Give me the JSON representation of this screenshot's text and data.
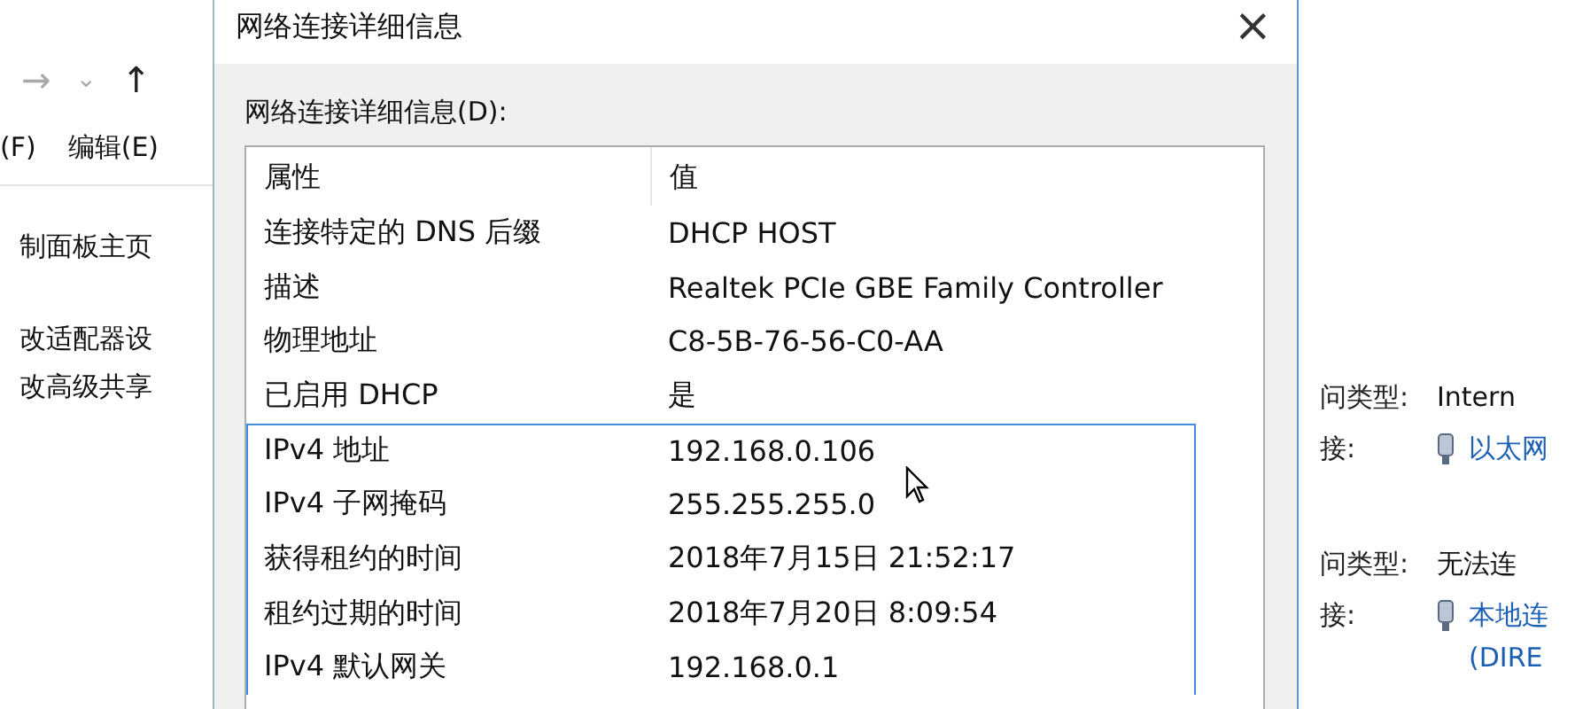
{
  "background_window": {
    "nav": {
      "forward": "→",
      "history": "⌄",
      "up": "↑"
    },
    "menu": [
      "(F)",
      "编辑(E)"
    ],
    "links": [
      "制面板主页",
      "改适配器设",
      "改高级共享"
    ]
  },
  "dialog": {
    "title": "网络连接详细信息",
    "close": "×",
    "label": "网络连接详细信息(D):",
    "table": {
      "columns": [
        "属性",
        "值"
      ],
      "rows": [
        {
          "property": "连接特定的 DNS 后缀",
          "value": "DHCP HOST",
          "highlighted": false
        },
        {
          "property": "描述",
          "value": "Realtek PCIe GBE Family Controller",
          "highlighted": false
        },
        {
          "property": "物理地址",
          "value": "C8-5B-76-56-C0-AA",
          "highlighted": false
        },
        {
          "property": "已启用 DHCP",
          "value": "是",
          "highlighted": false
        },
        {
          "property": "IPv4 地址",
          "value": "192.168.0.106",
          "highlighted": true
        },
        {
          "property": "IPv4 子网掩码",
          "value": "255.255.255.0",
          "highlighted": true
        },
        {
          "property": "获得租约的时间",
          "value": "2018年7月15日 21:52:17",
          "highlighted": true
        },
        {
          "property": "租约过期的时间",
          "value": "2018年7月20日 8:09:54",
          "highlighted": true
        },
        {
          "property": "IPv4 默认网关",
          "value": "192.168.0.1",
          "highlighted": true
        }
      ]
    }
  },
  "networks": [
    {
      "access_label": "问类型:",
      "access": "Intern",
      "connection_label": "接:",
      "connection": [
        "以太网"
      ]
    },
    {
      "access_label": "问类型:",
      "access": "无法连",
      "connection_label": "接:",
      "connection": [
        "本地连",
        "(DIRE"
      ]
    }
  ]
}
